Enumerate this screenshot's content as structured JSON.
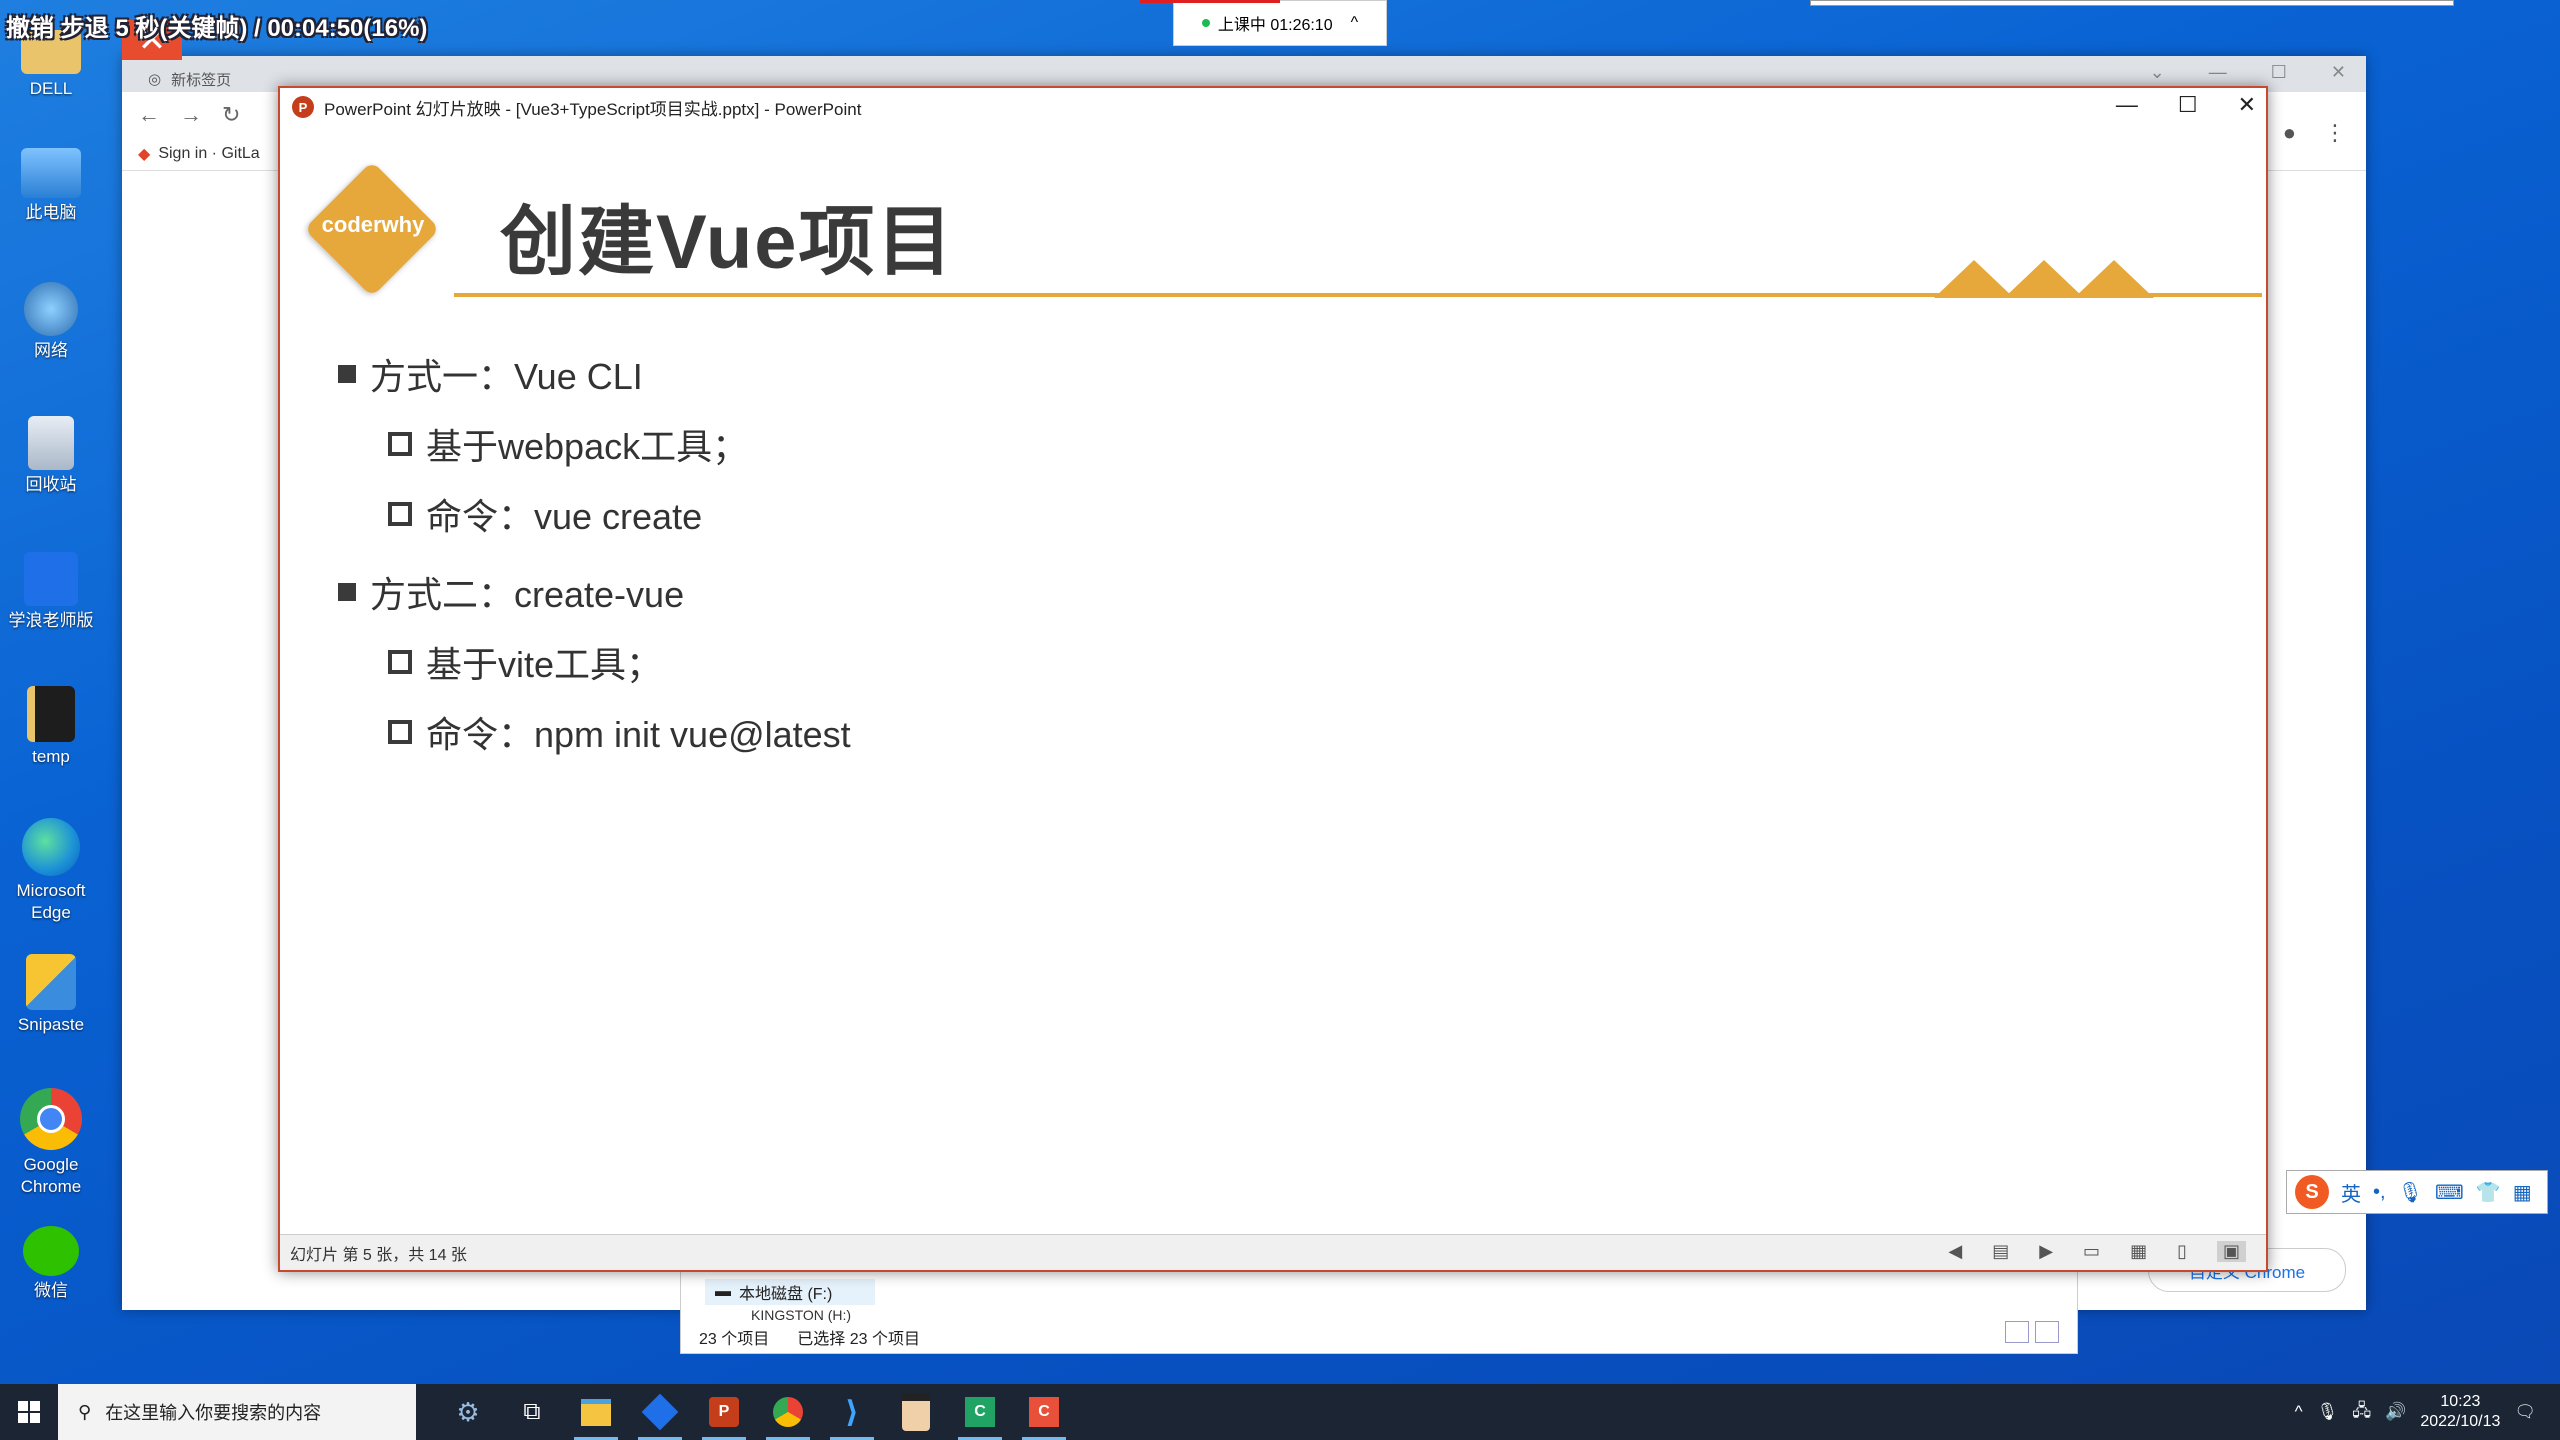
{
  "recorder": {
    "overlay_text": "撤销 步退 5 秒(关键帧) / 00:04:50(16%)",
    "live_status": "上课中 01:26:10",
    "live_collapse": "^"
  },
  "desktop_icons": [
    {
      "label": "DELL",
      "icon": "folder-icon"
    },
    {
      "label": "此电脑",
      "icon": "computer-icon"
    },
    {
      "label": "网络",
      "icon": "network-icon"
    },
    {
      "label": "回收站",
      "icon": "recycle-bin-icon"
    },
    {
      "label": "学浪老师版",
      "icon": "xuelang-icon"
    },
    {
      "label": "temp",
      "icon": "folder-icon"
    },
    {
      "label": "Microsoft Edge",
      "icon": "edge-icon"
    },
    {
      "label": "Snipaste",
      "icon": "snipaste-icon"
    },
    {
      "label": "Google Chrome",
      "icon": "chrome-icon"
    },
    {
      "label": "微信",
      "icon": "wechat-icon"
    }
  ],
  "chrome": {
    "tab_label": "新标签页",
    "bookmark_label": "Sign in · GitLa",
    "bottom_pill": "自定义 Chrome"
  },
  "powerpoint": {
    "window_title": "PowerPoint 幻灯片放映 - [Vue3+TypeScript项目实战.pptx] - PowerPoint",
    "slide": {
      "logo_text": "coderwhy",
      "title": "创建Vue项目",
      "bullets": [
        {
          "text": "方式一：Vue CLI",
          "sub": [
            "基于webpack工具；",
            "命令：vue create"
          ]
        },
        {
          "text": "方式二：create-vue",
          "sub": [
            "基于vite工具；",
            "命令：npm init vue@latest"
          ]
        }
      ]
    },
    "status": "幻灯片 第 5 张，共 14 张"
  },
  "explorer": {
    "drive": "本地磁盘 (F:)",
    "drive2": "KINGSTON (H:)",
    "item_count": "23 个项目",
    "selected": "已选择 23 个项目"
  },
  "ime": {
    "lang": "英"
  },
  "taskbar": {
    "search_placeholder": "在这里输入你要搜索的内容",
    "time": "10:23",
    "date": "2022/10/13"
  },
  "colors": {
    "accent": "#e6a73b",
    "ppt_border": "#c64a2f",
    "desktop": "#0a63d3"
  }
}
